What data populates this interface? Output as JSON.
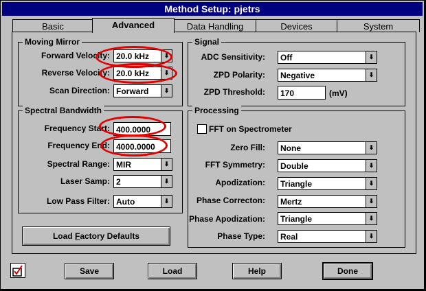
{
  "window": {
    "title": "Method Setup: pjetrs"
  },
  "tabs": [
    {
      "label": "Basic",
      "active": false
    },
    {
      "label": "Advanced",
      "active": true
    },
    {
      "label": "Data Handling",
      "active": false
    },
    {
      "label": "Devices",
      "active": false
    },
    {
      "label": "System",
      "active": false
    }
  ],
  "moving_mirror": {
    "title": "Moving Mirror",
    "forward_velocity": {
      "label": "Forward Velocity:",
      "value": "20.0 kHz"
    },
    "reverse_velocity": {
      "label": "Reverse Velocity:",
      "value": "20.0 kHz"
    },
    "scan_direction": {
      "label": "Scan Direction:",
      "value": "Forward"
    }
  },
  "spectral_bandwidth": {
    "title": "Spectral Bandwidth",
    "frequency_start": {
      "label": "Frequency Start:",
      "value": "400.0000"
    },
    "frequency_end": {
      "label": "Frequency End:",
      "value": "4000.0000"
    },
    "spectral_range": {
      "label": "Spectral Range:",
      "value": "MIR"
    },
    "laser_samp": {
      "label": "Laser Samp:",
      "value": "2"
    },
    "low_pass_filter": {
      "label": "Low Pass Filter:",
      "value": "Auto"
    }
  },
  "load_factory_defaults": {
    "label_pre": "Load ",
    "label_ul": "F",
    "label_post": "actory Defaults"
  },
  "signal": {
    "title": "Signal",
    "adc_sensitivity": {
      "label": "ADC Sensitivity:",
      "value": "Off"
    },
    "zpd_polarity": {
      "label": "ZPD Polarity:",
      "value": "Negative"
    },
    "zpd_threshold": {
      "label": "ZPD Threshold:",
      "value": "170",
      "unit": "(mV)"
    }
  },
  "processing": {
    "title": "Processing",
    "fft_on_spectrometer": {
      "label": "FFT on Spectrometer",
      "checked": false
    },
    "zero_fill": {
      "label": "Zero Fill:",
      "value": "None"
    },
    "fft_symmetry": {
      "label": "FFT Symmetry:",
      "value": "Double"
    },
    "apodization": {
      "label": "Apodization:",
      "value": "Triangle"
    },
    "phase_correction": {
      "label": "Phase Correcton:",
      "value": "Mertz"
    },
    "phase_apodization": {
      "label": "Phase Apodization:",
      "value": "Triangle"
    },
    "phase_type": {
      "label": "Phase Type:",
      "value": "Real"
    }
  },
  "buttons": {
    "save": "Save",
    "load": "Load",
    "help": "Help",
    "done": "Done"
  },
  "colors": {
    "title_bar": "#000080",
    "window_bg": "#c0c0c0",
    "annotation": "#e00000"
  }
}
